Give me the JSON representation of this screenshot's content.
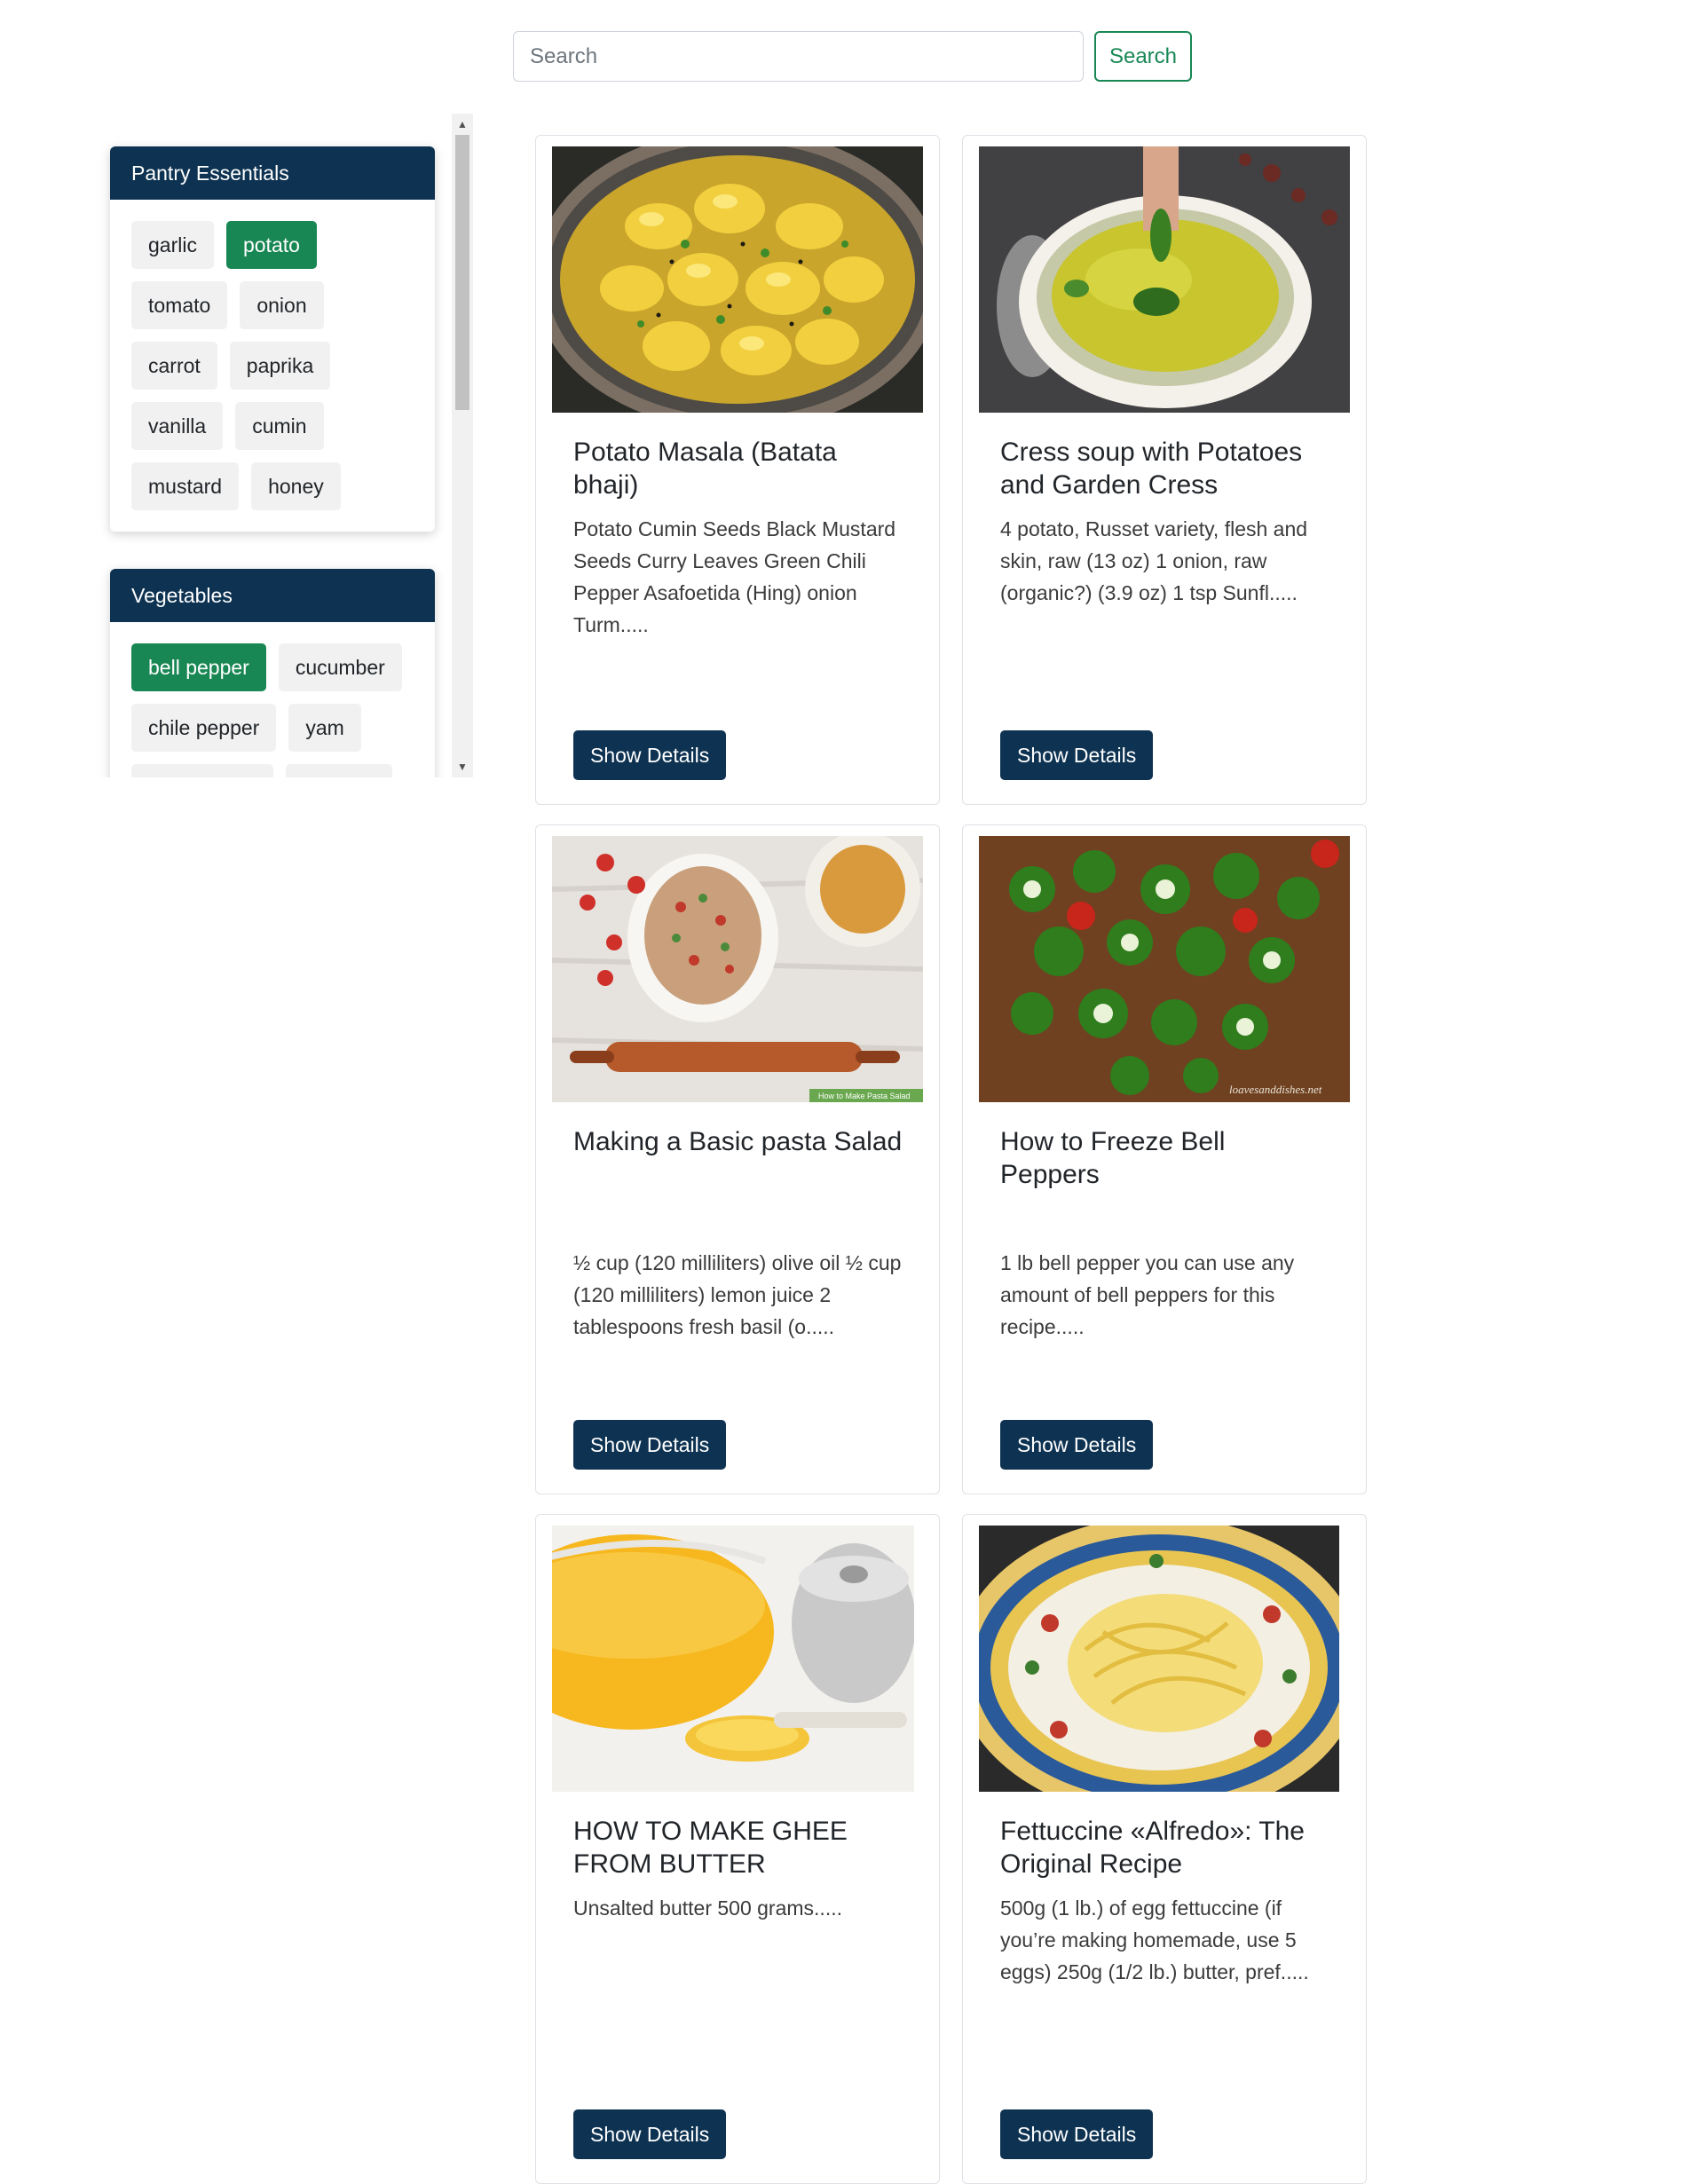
{
  "search": {
    "placeholder": "Search",
    "button_label": "Search"
  },
  "sidebar": {
    "categories": [
      {
        "title": "Pantry Essentials",
        "tags": [
          {
            "label": "garlic",
            "selected": false
          },
          {
            "label": "potato",
            "selected": true
          },
          {
            "label": "tomato",
            "selected": false
          },
          {
            "label": "onion",
            "selected": false
          },
          {
            "label": "carrot",
            "selected": false
          },
          {
            "label": "paprika",
            "selected": false
          },
          {
            "label": "vanilla",
            "selected": false
          },
          {
            "label": "cumin",
            "selected": false
          },
          {
            "label": "mustard",
            "selected": false
          },
          {
            "label": "honey",
            "selected": false
          }
        ]
      },
      {
        "title": "Vegetables",
        "tags": [
          {
            "label": "bell pepper",
            "selected": true
          },
          {
            "label": "cucumber",
            "selected": false
          },
          {
            "label": "chile pepper",
            "selected": false
          },
          {
            "label": "yam",
            "selected": false
          }
        ]
      }
    ]
  },
  "recipes": [
    {
      "title": "Potato Masala (Batata bhaji)",
      "snippet": "Potato Cumin Seeds Black Mustard Seeds Curry Leaves Green Chili Pepper Asafoetida (Hing) onion Turm.....",
      "button_label": "Show Details",
      "image_icon": "potato-masala-photo"
    },
    {
      "title": "Cress soup with Potatoes and Garden Cress",
      "snippet": "4 potato, Russet variety, flesh and skin, raw (13 oz) 1 onion, raw (organic?) (3.9 oz) 1 tsp Sunfl.....",
      "button_label": "Show Details",
      "image_icon": "cress-soup-photo"
    },
    {
      "title": "Making a Basic pasta Salad",
      "snippet": "½ cup (120 milliliters) olive oil ½ cup (120 milliliters) lemon juice 2 tablespoons fresh basil (o.....",
      "button_label": "Show Details",
      "image_icon": "pasta-salad-photo",
      "image_caption": "How to Make Pasta Salad"
    },
    {
      "title": "How to Freeze Bell Peppers",
      "snippet": "1 lb bell pepper you can use any amount of bell peppers for this recipe.....",
      "button_label": "Show Details",
      "image_icon": "bell-peppers-photo",
      "image_caption": "loavesanddishes.net"
    },
    {
      "title": "HOW TO MAKE GHEE FROM BUTTER",
      "snippet": "Unsalted butter 500 grams.....",
      "button_label": "Show Details",
      "image_icon": "ghee-photo"
    },
    {
      "title": "Fettuccine «Alfredo»: The Original Recipe",
      "snippet": "500g (1 lb.) of egg fettuccine (if you’re making homemade, use 5 eggs) 250g (1/2 lb.) butter, pref.....",
      "button_label": "Show Details",
      "image_icon": "fettuccine-photo"
    }
  ],
  "colors": {
    "header_navy": "#0e3352",
    "selected_green": "#198754",
    "tag_grey": "#f1f1f1"
  }
}
